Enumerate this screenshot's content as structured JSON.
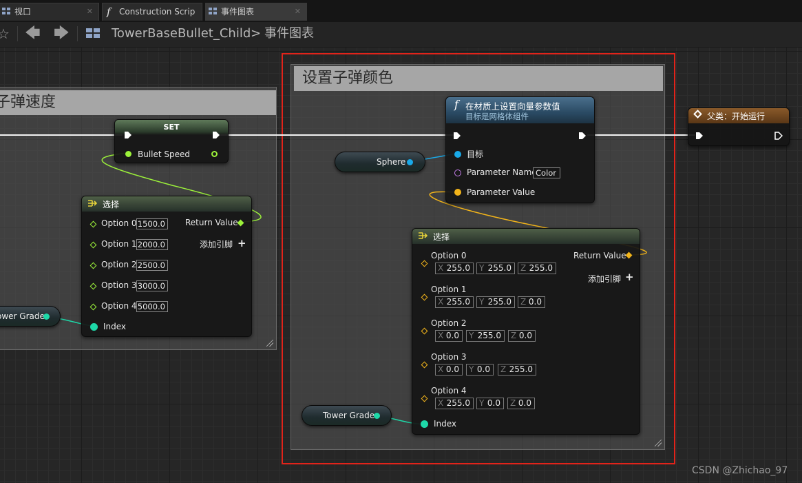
{
  "tabs": [
    {
      "label": "视口",
      "icon": "grid-icon"
    },
    {
      "label": "Construction Scrip",
      "icon": "function-icon"
    },
    {
      "label": "事件图表",
      "icon": "grid-icon"
    }
  ],
  "breadcrumb": {
    "blueprint": "TowerBaseBullet_Child",
    "separator": ">",
    "graph": "事件图表"
  },
  "comments": {
    "left": {
      "title": "子弹速度"
    },
    "right": {
      "title": "设置子弹颜色"
    }
  },
  "set_node": {
    "title": "SET",
    "input_label": "Bullet Speed"
  },
  "select_speed": {
    "title": "选择",
    "return_label": "Return Value",
    "add_pin_label": "添加引脚",
    "index_label": "Index",
    "options": [
      {
        "label": "Option 0",
        "value": "1500.0"
      },
      {
        "label": "Option 1",
        "value": "2000.0"
      },
      {
        "label": "Option 2",
        "value": "2500.0"
      },
      {
        "label": "Option 3",
        "value": "3000.0"
      },
      {
        "label": "Option 4",
        "value": "5000.0"
      }
    ]
  },
  "tower_grade_left": {
    "label": "ower Grade"
  },
  "tower_grade_right": {
    "label": "Tower Grade"
  },
  "sphere_node": {
    "label": "Sphere"
  },
  "material_node": {
    "title": "在材质上设置向量参数值",
    "subtitle": "目标是网格体组件",
    "target_label": "目标",
    "param_name_label": "Parameter Name",
    "param_name_value": "Color",
    "param_value_label": "Parameter Value"
  },
  "parent_node": {
    "title": "父类：开始运行"
  },
  "select_color": {
    "title": "选择",
    "return_label": "Return Value",
    "add_pin_label": "添加引脚",
    "index_label": "Index",
    "options": [
      {
        "label": "Option 0",
        "x": "255.0",
        "y": "255.0",
        "z": "255.0"
      },
      {
        "label": "Option 1",
        "x": "255.0",
        "y": "255.0",
        "z": "0.0"
      },
      {
        "label": "Option 2",
        "x": "0.0",
        "y": "255.0",
        "z": "0.0"
      },
      {
        "label": "Option 3",
        "x": "0.0",
        "y": "0.0",
        "z": "255.0"
      },
      {
        "label": "Option 4",
        "x": "255.0",
        "y": "0.0",
        "z": "0.0"
      }
    ]
  },
  "vector_axes": {
    "x": "X",
    "y": "Y",
    "z": "Z"
  },
  "watermark": "CSDN @Zhichao_97",
  "colors": {
    "exec_wire": "#ffffff",
    "float_pin": "#9cf23a",
    "int_pin": "#1ed8a8",
    "object_pin": "#19a9e8",
    "name_pin": "#c47de8",
    "struct_pin": "#f2b41a",
    "highlight_box": "#e2231a"
  }
}
